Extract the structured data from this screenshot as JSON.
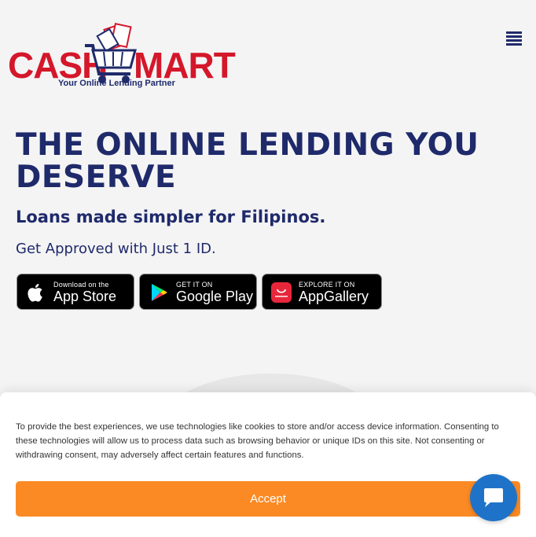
{
  "brand": {
    "name_left": "CASH",
    "name_right": "MART",
    "tagline": "Your Online Lending Partner",
    "red": "#d4172a",
    "navy": "#1f2a6b"
  },
  "header": {
    "menu_icon": "hamburger-menu-icon"
  },
  "hero": {
    "title": "THE ONLINE LENDING YOU DESERVE",
    "subtitle": "Loans made simpler for Filipinos.",
    "note": "Get Approved with Just 1 ID."
  },
  "stores": [
    {
      "small": "Download on the",
      "big": "App Store",
      "icon": "apple-icon"
    },
    {
      "small": "GET IT ON",
      "big": "Google Play",
      "icon": "google-play-icon"
    },
    {
      "small": "EXPLORE IT ON",
      "big": "AppGallery",
      "icon": "huawei-appgallery-icon"
    }
  ],
  "consent": {
    "text": "To provide the best experiences, we use technologies like cookies to store and/or access device information. Consenting to these technologies will allow us to process data such as browsing behavior or unique IDs on this site. Not consenting or withdrawing consent, may adversely affect certain features and functions.",
    "accept_label": "Accept",
    "accent": "#fb8a24"
  },
  "chat": {
    "icon": "chat-bubble-icon",
    "color": "#1e73c8"
  }
}
